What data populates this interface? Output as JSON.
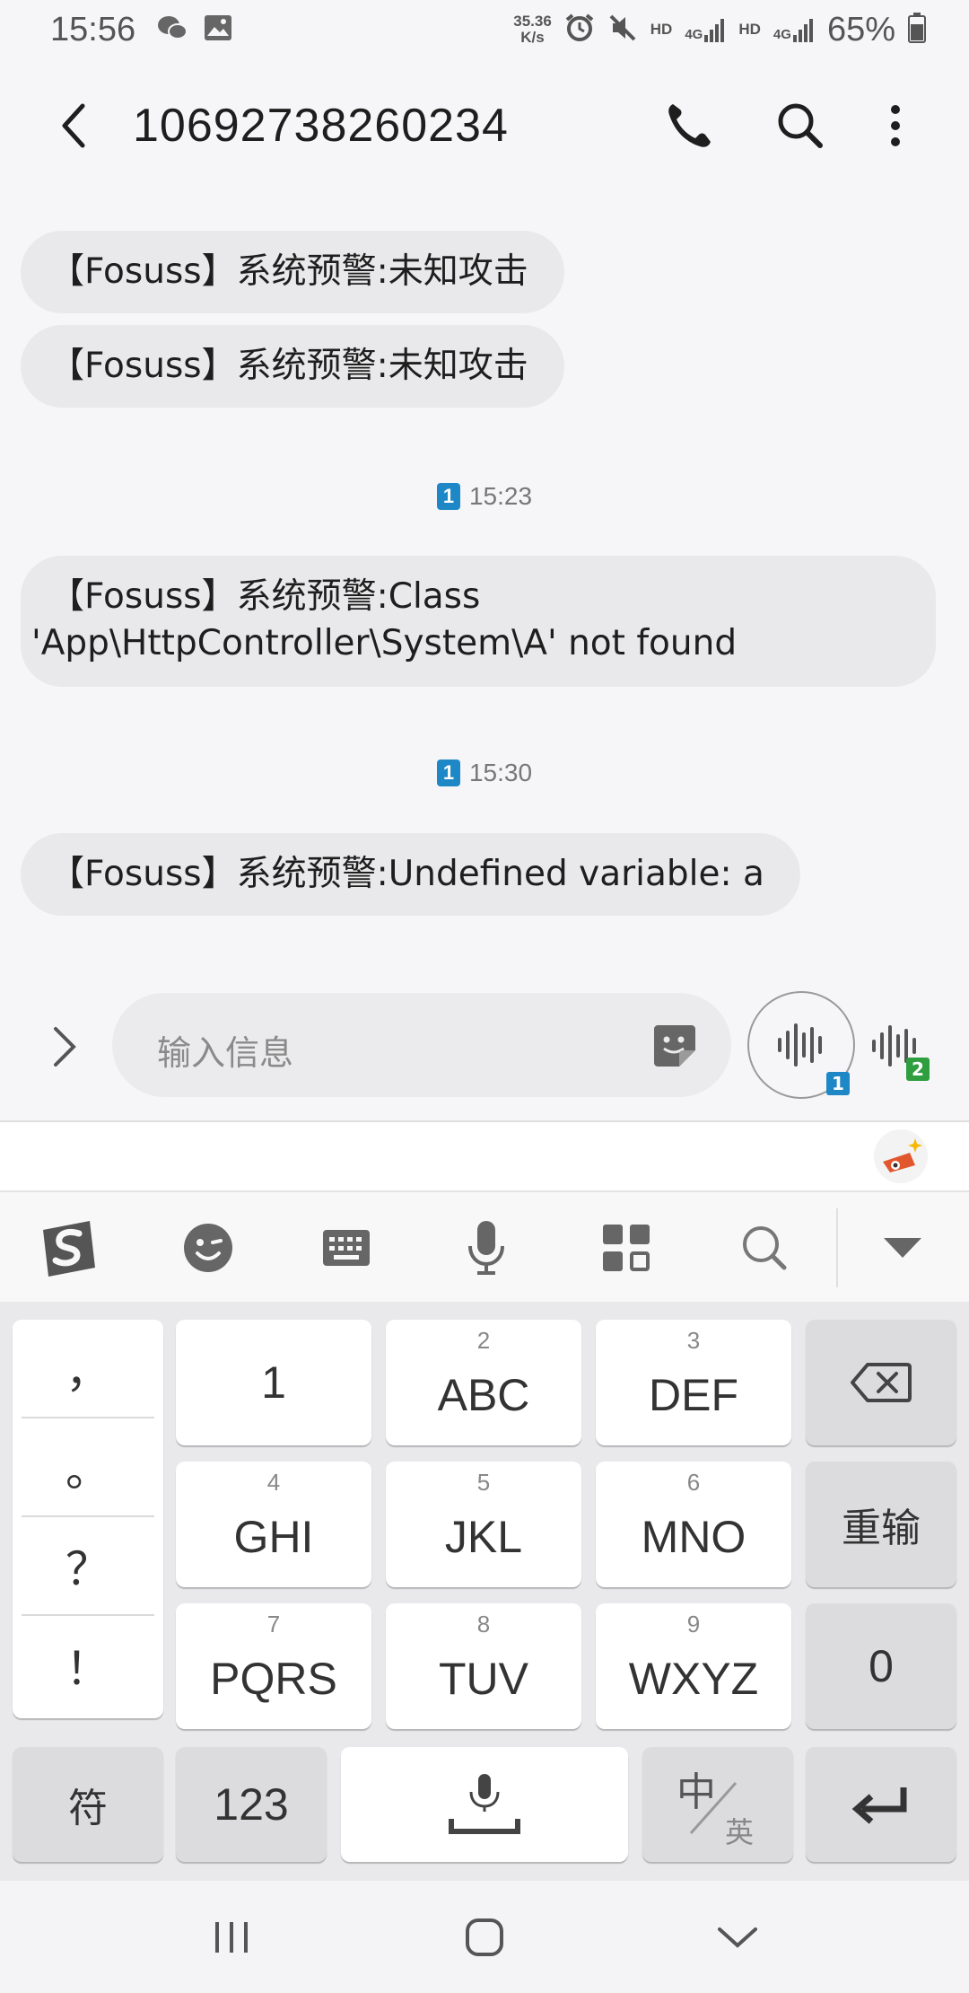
{
  "status_bar": {
    "time": "15:56",
    "speed_value": "35.36",
    "speed_unit": "K/s",
    "sim1_hd": "HD",
    "sim1_net": "4G",
    "sim2_hd": "HD",
    "sim2_net": "4G",
    "battery": "65%",
    "icons": [
      "wechat-icon",
      "gallery-icon",
      "alarm-icon",
      "mute-icon",
      "signal-icon",
      "battery-icon"
    ]
  },
  "header": {
    "title": "10692738260234",
    "icons": [
      "back-arrow-icon",
      "phone-icon",
      "search-icon",
      "more-vertical-icon"
    ]
  },
  "messages": [
    {
      "text": "【Fosuss】系统预警:未知攻击"
    },
    {
      "text": "【Fosuss】系统预警:未知攻击"
    },
    {
      "line1": "【Fosuss】系统预警:Class",
      "line2": "'App\\HttpController\\System\\A' not found"
    },
    {
      "text": "【Fosuss】系统预警:Undefined variable: a"
    }
  ],
  "timestamps": [
    {
      "sim": "1",
      "time": "15:23"
    },
    {
      "sim": "1",
      "time": "15:30"
    }
  ],
  "composer": {
    "placeholder": "输入信息",
    "voice_sim1_badge": "1",
    "voice_sim2_badge": "2",
    "accent_sim1": "#1e88c7",
    "accent_sim2": "#2e9e3e"
  },
  "keyboard": {
    "toolbar_icons": [
      "sogou-logo-icon",
      "emoji-icon",
      "keyboard-icon",
      "mic-icon",
      "apps-grid-icon",
      "search-icon",
      "collapse-icon"
    ],
    "punctuation": [
      "，",
      "。",
      "？",
      "！"
    ],
    "keys": {
      "k1": {
        "label": "1"
      },
      "k2": {
        "num": "2",
        "label": "ABC"
      },
      "k3": {
        "num": "3",
        "label": "DEF"
      },
      "k4": {
        "num": "4",
        "label": "GHI"
      },
      "k5": {
        "num": "5",
        "label": "JKL"
      },
      "k6": {
        "num": "6",
        "label": "MNO"
      },
      "k7": {
        "num": "7",
        "label": "PQRS"
      },
      "k8": {
        "num": "8",
        "label": "TUV"
      },
      "k9": {
        "num": "9",
        "label": "WXYZ"
      },
      "reset": "重输",
      "zero": "0",
      "symbols": "符",
      "numbers": "123",
      "lang_zh": "中",
      "lang_en": "英"
    }
  },
  "nav_bar": {
    "icons": [
      "recent-apps-icon",
      "home-icon",
      "back-chevron-icon"
    ]
  }
}
